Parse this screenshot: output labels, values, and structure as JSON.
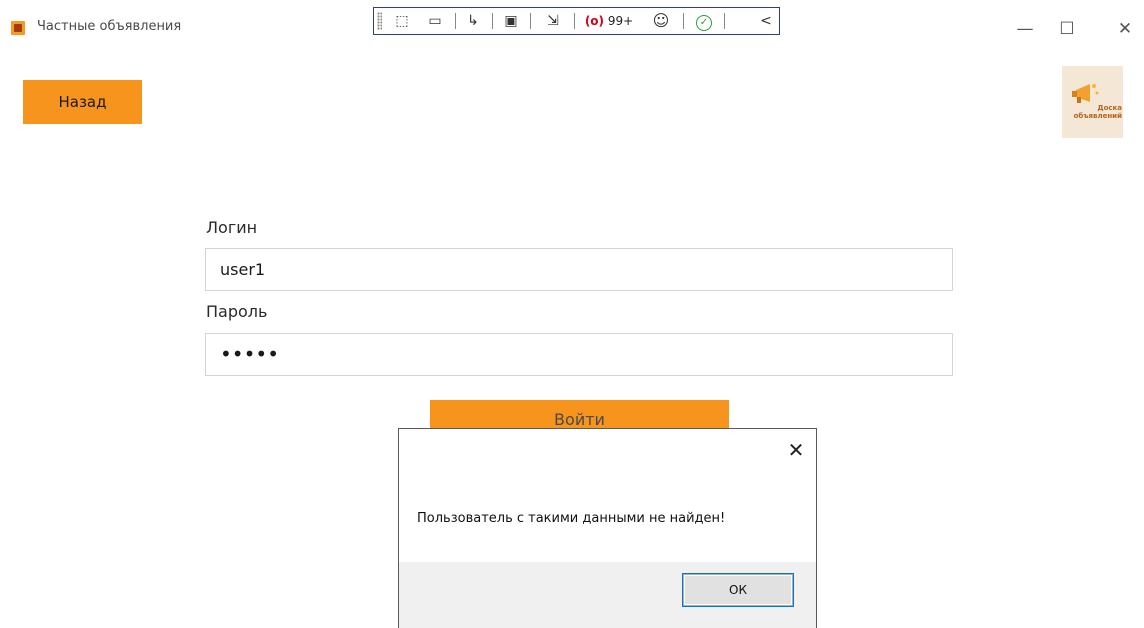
{
  "window": {
    "title": "Частные объявления",
    "minimize_symbol": "—",
    "maximize_symbol": "☐",
    "close_symbol": "✕"
  },
  "debug_toolbar": {
    "items": [
      {
        "icon": "select-element-icon",
        "glyph": "⬚"
      },
      {
        "icon": "camera-icon",
        "glyph": "▭"
      },
      {
        "icon": "pointer-icon",
        "glyph": "↳"
      },
      {
        "icon": "layout-adorner-icon",
        "glyph": "▣"
      },
      {
        "icon": "track-focus-icon",
        "glyph": "⇲"
      }
    ],
    "badge_count": "99+",
    "badge_glyph": "(o)",
    "accessibility_glyph": "☺",
    "check_glyph": "✓",
    "collapse_glyph": "<"
  },
  "back_button": {
    "label": "Назад"
  },
  "logo": {
    "text": "Доска объявлений"
  },
  "form": {
    "login_label": "Логин",
    "login_value": "user1",
    "password_label": "Пароль",
    "password_value": "•••••",
    "submit_label": "Войти"
  },
  "dialog": {
    "close_symbol": "✕",
    "message": "Пользователь с такими данными не найден!",
    "ok_label": "ОК"
  },
  "colors": {
    "accent": "#f7941d",
    "dialog_footer": "#f0f0f0",
    "focus_outline": "#0078d7"
  }
}
